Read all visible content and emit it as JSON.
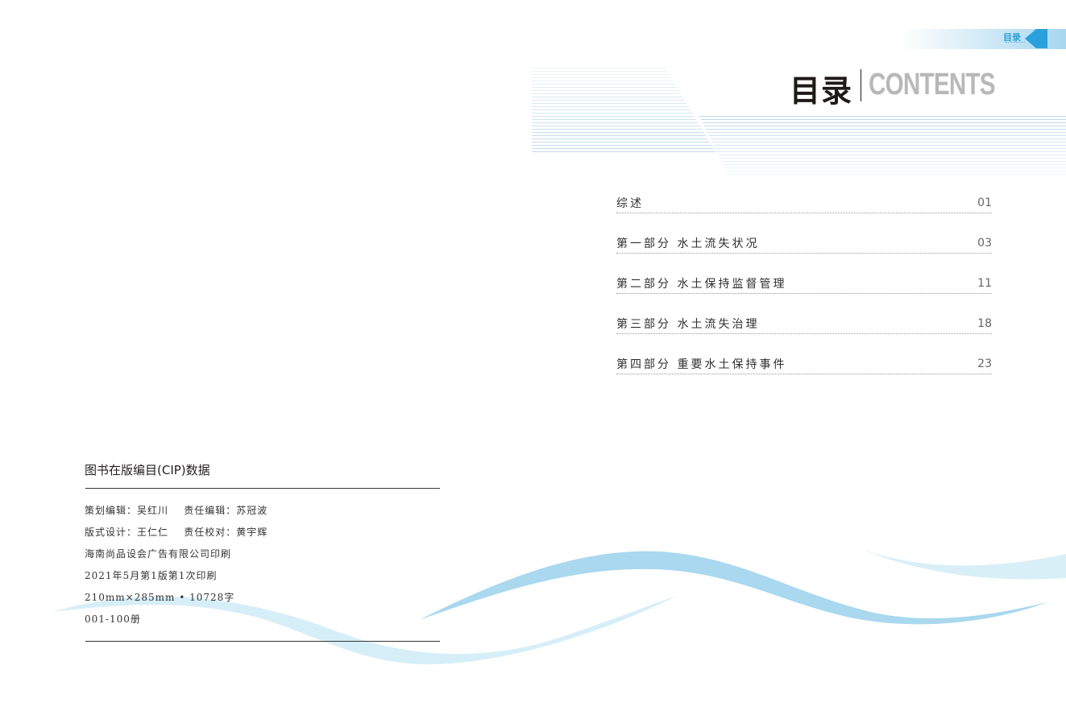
{
  "tab": {
    "label": "目录"
  },
  "heading": {
    "cn": "目录",
    "en": "CONTENTS"
  },
  "toc": [
    {
      "title": "综述",
      "page": "01"
    },
    {
      "title": "第一部分 水土流失状况",
      "page": "03"
    },
    {
      "title": "第二部分 水土保持监督管理",
      "page": "11"
    },
    {
      "title": "第三部分 水土流失治理",
      "page": "18"
    },
    {
      "title": "第四部分 重要水土保持事件",
      "page": "23"
    }
  ],
  "cip": {
    "title": "图书在版编目(CIP)数据",
    "lines": [
      "策划编辑：吴红川    责任编辑：苏冠波",
      "版式设计：王仁仁    责任校对：黄宇辉",
      "海南尚品设会广告有限公司印刷",
      "2021年5月第1版第1次印刷",
      "210mm×285mm • 10728字",
      "001-100册"
    ]
  },
  "colors": {
    "accent": "#2aa0dd",
    "wave_light": "#d9eff8",
    "wave_mid": "#a9d8ef"
  }
}
